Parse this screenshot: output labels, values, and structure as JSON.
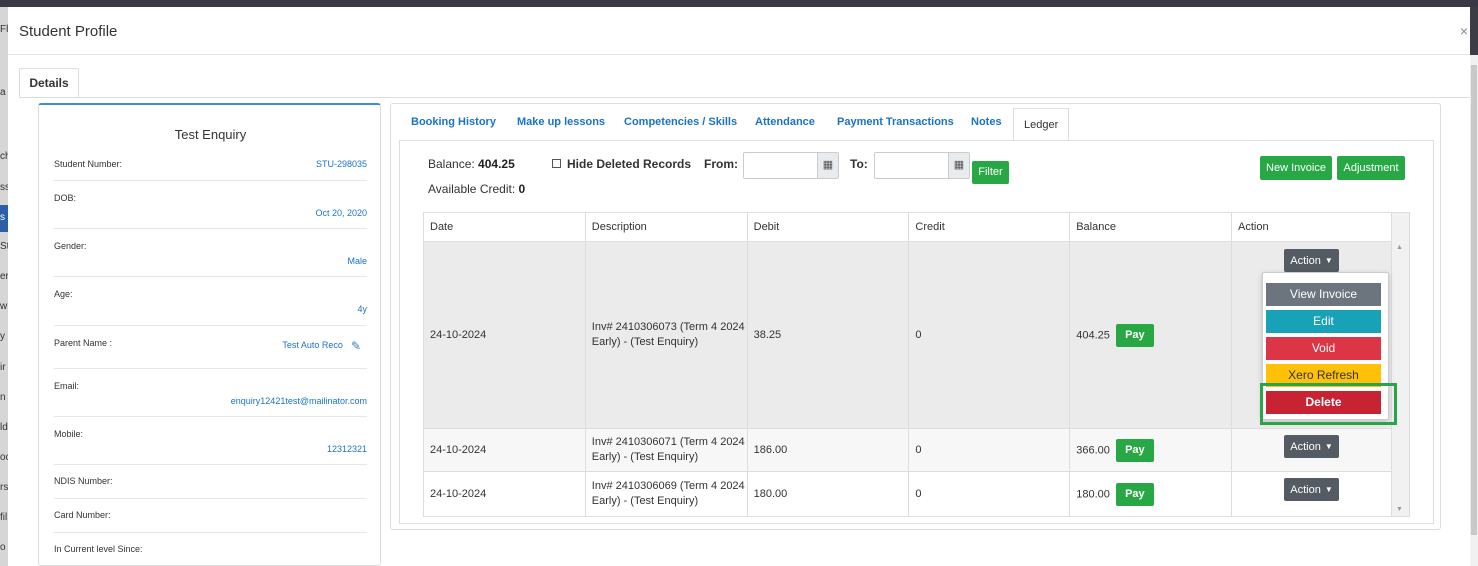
{
  "modal": {
    "title": "Student Profile",
    "close": "×"
  },
  "tabs": {
    "details": "Details"
  },
  "background_fragments": [
    "Fl",
    "a",
    "ch",
    "ss",
    "s",
    "St",
    "er",
    "w",
    "y",
    "ir",
    "n",
    "ld",
    "oc",
    "rs",
    "fil",
    "o"
  ],
  "profile": {
    "name": "Test Enquiry",
    "fields": [
      {
        "label": "Student Number:",
        "value": "STU-298035"
      },
      {
        "label": "DOB:",
        "value": "Oct 20, 2020"
      },
      {
        "label": "Gender:",
        "value": "Male"
      },
      {
        "label": "Age:",
        "value": "4y"
      },
      {
        "label": "Parent Name :",
        "value": "Test Auto Reco"
      },
      {
        "label": "Email:",
        "value": "enquiry12421test@mailinator.com"
      },
      {
        "label": "Mobile:",
        "value": "12312321"
      },
      {
        "label": "NDIS Number:",
        "value": ""
      },
      {
        "label": "Card Number:",
        "value": ""
      },
      {
        "label": "In Current level Since:",
        "value": ""
      }
    ]
  },
  "subtabs": [
    "Booking History",
    "Make up lessons",
    "Competencies / Skills",
    "Attendance",
    "Payment Transactions",
    "Notes",
    "Ledger"
  ],
  "ledger": {
    "balance_label": "Balance:",
    "balance_value": "404.25",
    "available_credit_label": "Available Credit:",
    "available_credit_value": "0",
    "hide_deleted_label": "Hide Deleted Records",
    "from_label": "From:",
    "to_label": "To:",
    "calendar_icon": "calendar-icon",
    "filter_button": "Filter",
    "new_invoice_button": "New Invoice",
    "adjustment_button": "Adjustment",
    "columns": [
      "Date",
      "Description",
      "Debit",
      "Credit",
      "Balance",
      "Action"
    ],
    "rows": [
      {
        "date": "24-10-2024",
        "desc1": "Inv# 2410306073 (Term 4 2024",
        "desc2": "Early) - (Test Enquiry)",
        "debit": "38.25",
        "credit": "0",
        "balance": "404.25",
        "pay": "Pay",
        "action": "Action"
      },
      {
        "date": "24-10-2024",
        "desc1": "Inv# 2410306071 (Term 4 2024",
        "desc2": "Early) - (Test Enquiry)",
        "debit": "186.00",
        "credit": "0",
        "balance": "366.00",
        "pay": "Pay",
        "action": "Action"
      },
      {
        "date": "24-10-2024",
        "desc1": "Inv# 2410306069 (Term 4 2024",
        "desc2": "Early) - (Test Enquiry)",
        "debit": "180.00",
        "credit": "0",
        "balance": "180.00",
        "pay": "Pay",
        "action": "Action"
      }
    ],
    "dropdown": [
      {
        "label": "View Invoice",
        "color": "#6c757d"
      },
      {
        "label": "Edit",
        "color": "#17a2b8"
      },
      {
        "label": "Void",
        "color": "#dc3545"
      },
      {
        "label": "Xero Refresh",
        "color": "#ffc107"
      },
      {
        "label": "Delete",
        "color": "#c82333"
      }
    ]
  },
  "colors": {
    "link": "#1a73c7",
    "success": "#28a745",
    "highlight": "#2aa34a",
    "action": "#545b62"
  }
}
